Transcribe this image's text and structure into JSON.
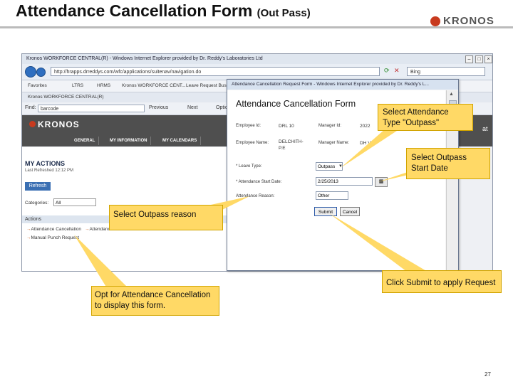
{
  "slide": {
    "title": "Attendance Cancellation Form",
    "title_suffix": "(Out Pass)",
    "logo_text": "KRONOS",
    "page_number": "27"
  },
  "background_browser": {
    "window_title": "Kronos WORKFORCE CENTRAL(R) - Windows Internet Explorer provided by Dr. Reddy's Laboratories Ltd",
    "address": "http://hrapps.drreddys.com/wfc/applications/suitenav/navigation.do",
    "search_text": "Bing",
    "favorites": [
      "Favorites",
      "LTRS",
      "HRMS",
      "Kronos WORKFORCE CENT...",
      "Leave Request Business",
      "Fi"
    ],
    "tab_label": "Kronos WORKFORCE CENTRAL(R)",
    "find_label": "Find:",
    "find_value": "barcode",
    "find_prev": "Previous",
    "find_next": "Next",
    "options": "Options",
    "app_logo": "KRONOS",
    "nav_items": [
      "GENERAL",
      "MY INFORMATION",
      "MY CALENDARS"
    ],
    "side_text": "at",
    "panel": {
      "heading": "MY ACTIONS",
      "last_refreshed": "Last Refreshed 12:12 PM",
      "refresh_button": "Refresh",
      "categories_label": "Categories:",
      "categories_value": "All",
      "actions_header": "Actions",
      "actions": [
        "Attendance Cancellation",
        "Attendance",
        "Manual Punch Request"
      ]
    }
  },
  "popup": {
    "window_title": "Attendance Cancellation Request Form - Windows Internet Explorer provided by Dr. Reddy's L...",
    "heading": "Attendance Cancellation Form",
    "employee_id_label": "Employee Id:",
    "employee_id_value": "DRL 10",
    "manager_id_label": "Manager Id:",
    "manager_id_value": "2022",
    "employee_name_label": "Employee Name:",
    "employee_name_value": "DELCHITH-P.E",
    "manager_name_label": "Manager Name:",
    "manager_name_value": "DH Van",
    "leave_type_label": "* Leave Type:",
    "leave_type_value": "Outpass",
    "start_date_label": "* Attendance Start Date:",
    "start_date_value": "2/25/2013",
    "reason_label": "Attendance Reason:",
    "reason_value": "Other",
    "submit_button": "Submit",
    "cancel_button": "Cancel"
  },
  "callouts": {
    "type": "Select Attendance Type \"Outpass\"",
    "start_date": "Select Outpass Start Date",
    "reason": "Select Outpass reason",
    "submit": "Click Submit to apply Request",
    "opt": "Opt for Attendance Cancellation to display this form."
  },
  "colors": {
    "callout_fill": "#ffd966",
    "kronos_red": "#c83a1e",
    "app_header": "#4f4f4f"
  }
}
